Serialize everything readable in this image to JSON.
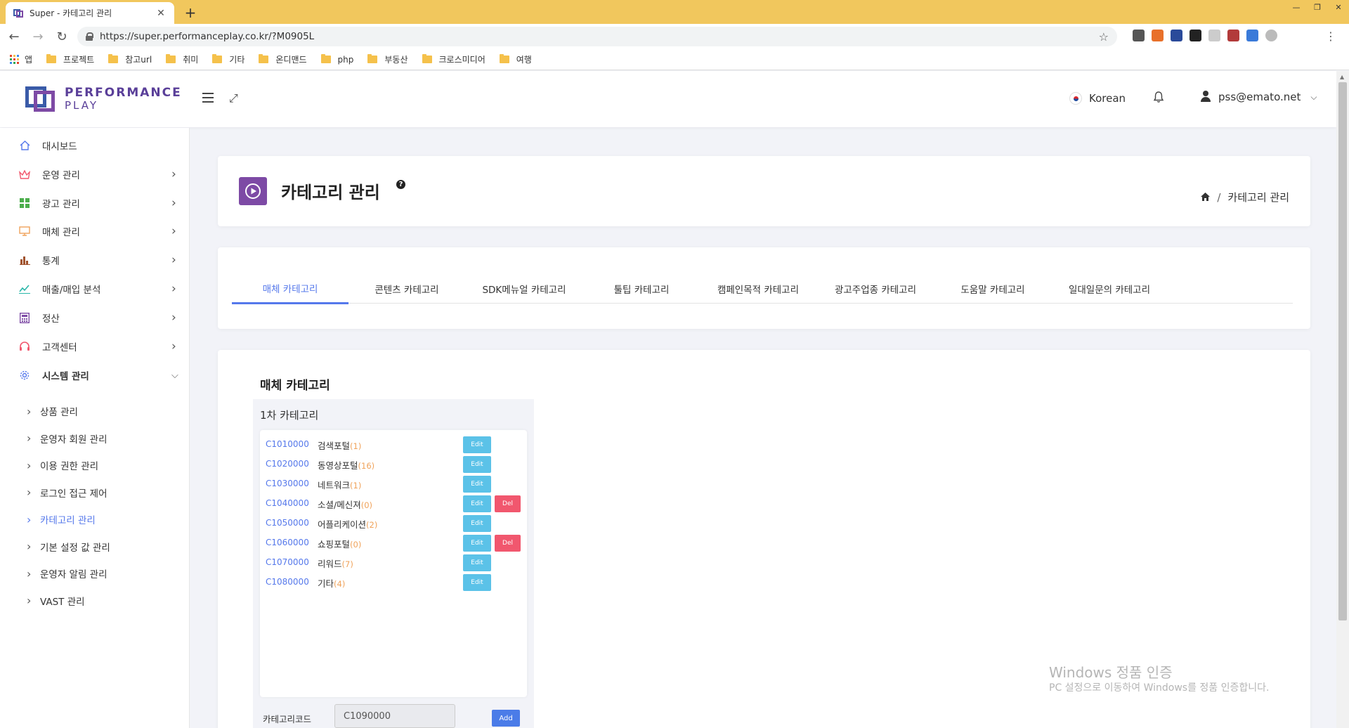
{
  "browser": {
    "tab_title": "Super - 카테고리 관리",
    "tab_close": "✕",
    "new_tab": "+",
    "url": "https://super.performanceplay.co.kr/?M0905L",
    "bookmarks": [
      "앱",
      "프로젝트",
      "참고url",
      "취미",
      "기타",
      "온디맨드",
      "php",
      "부동산",
      "크로스미디어",
      "여행"
    ],
    "extension_colors": [
      "#555555",
      "#e8702a",
      "#2a4a9a",
      "#222222",
      "#cccccc",
      "#b23a3a",
      "#3a7ad9",
      "#bbbbbb"
    ]
  },
  "header": {
    "logo_line1": "PERFORMANCE",
    "logo_line2": "PLAY",
    "language": "Korean",
    "user_email": "pss@emato.net"
  },
  "sidebar": {
    "items": [
      {
        "label": "대시보드",
        "icon": "home-icon",
        "color": "#5578eb",
        "expandable": false
      },
      {
        "label": "운영 관리",
        "icon": "crown-icon",
        "color": "#f1576e",
        "expandable": true
      },
      {
        "label": "광고 관리",
        "icon": "grid-icon",
        "color": "#4cae4c",
        "expandable": true
      },
      {
        "label": "매체 관리",
        "icon": "monitor-icon",
        "color": "#f0a35b",
        "expandable": true
      },
      {
        "label": "통계",
        "icon": "bar-chart-icon",
        "color": "#a0522d",
        "expandable": true
      },
      {
        "label": "매출/매입 분석",
        "icon": "line-chart-icon",
        "color": "#2ab7a9",
        "expandable": true
      },
      {
        "label": "정산",
        "icon": "calculator-icon",
        "color": "#7d4aa5",
        "expandable": true
      },
      {
        "label": "고객센터",
        "icon": "headset-icon",
        "color": "#f1576e",
        "expandable": true
      },
      {
        "label": "시스템 관리",
        "icon": "gear-icon",
        "color": "#5578eb",
        "expandable": true,
        "expanded": true
      }
    ],
    "sub_items": [
      {
        "label": "상품 관리"
      },
      {
        "label": "운영자 회원 관리"
      },
      {
        "label": "이용 권한 관리"
      },
      {
        "label": "로그인 접근 제어"
      },
      {
        "label": "카테고리 관리",
        "active": true
      },
      {
        "label": "기본 설정 값 관리"
      },
      {
        "label": "운영자 알림 관리"
      },
      {
        "label": "VAST 관리"
      }
    ]
  },
  "page": {
    "title": "카테고리 관리",
    "help": "?",
    "breadcrumb": [
      "카테고리 관리"
    ],
    "accent_color": "#7d4aa5"
  },
  "tabs": [
    {
      "label": "매체 카테고리",
      "active": true
    },
    {
      "label": "콘텐츠 카테고리"
    },
    {
      "label": "SDK메뉴얼 카테고리"
    },
    {
      "label": "툴팁 카테고리"
    },
    {
      "label": "캠페인목적 카테고리"
    },
    {
      "label": "광고주업종 카테고리"
    },
    {
      "label": "도움말 카테고리"
    },
    {
      "label": "일대일문의 카테고리"
    }
  ],
  "category_section": {
    "title": "매체 카테고리",
    "level_heading": "1차 카테고리",
    "edit_label": "Edit",
    "del_label": "Del",
    "rows": [
      {
        "code": "C1010000",
        "name": "검색포털",
        "count": "(1)",
        "deletable": false
      },
      {
        "code": "C1020000",
        "name": "동영상포털",
        "count": "(16)",
        "deletable": false
      },
      {
        "code": "C1030000",
        "name": "네트워크",
        "count": "(1)",
        "deletable": false
      },
      {
        "code": "C1040000",
        "name": "소셜/메신져",
        "count": "(0)",
        "deletable": true
      },
      {
        "code": "C1050000",
        "name": "어플리케이션",
        "count": "(2)",
        "deletable": false
      },
      {
        "code": "C1060000",
        "name": "쇼핑포털",
        "count": "(0)",
        "deletable": true
      },
      {
        "code": "C1070000",
        "name": "리워드",
        "count": "(7)",
        "deletable": false
      },
      {
        "code": "C1080000",
        "name": "기타",
        "count": "(4)",
        "deletable": false
      }
    ],
    "code_label": "카테고리코드",
    "code_value": "C1090000",
    "add_label": "Add"
  },
  "watermark": {
    "line1": "Windows 정품 인증",
    "line2": "PC 설정으로 이동하여 Windows를 정품 인증합니다."
  }
}
